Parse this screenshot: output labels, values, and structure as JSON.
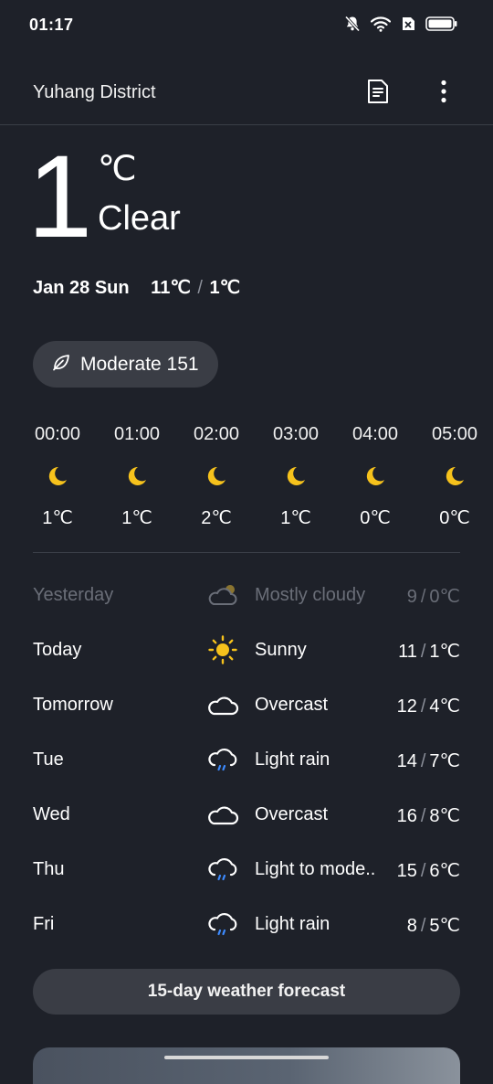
{
  "status_bar": {
    "time": "01:17",
    "icons": [
      "bell-off-icon",
      "wifi-icon",
      "sim-x-icon",
      "battery-icon"
    ]
  },
  "header": {
    "location": "Yuhang District",
    "doc_icon": "document-icon",
    "more_icon": "more-vertical-icon"
  },
  "current": {
    "temperature": "1",
    "unit": "℃",
    "condition": "Clear",
    "date": "Jan 28 Sun",
    "high": "11℃",
    "separator": "/",
    "low": "1℃"
  },
  "aqi": {
    "icon": "leaf-icon",
    "label": "Moderate 151"
  },
  "hourly": [
    {
      "time": "00:00",
      "icon": "moon-icon",
      "temp": "1℃"
    },
    {
      "time": "01:00",
      "icon": "moon-icon",
      "temp": "1℃"
    },
    {
      "time": "02:00",
      "icon": "moon-icon",
      "temp": "2℃"
    },
    {
      "time": "03:00",
      "icon": "moon-icon",
      "temp": "1℃"
    },
    {
      "time": "04:00",
      "icon": "moon-icon",
      "temp": "0℃"
    },
    {
      "time": "05:00",
      "icon": "moon-icon",
      "temp": "0℃"
    }
  ],
  "daily": [
    {
      "day": "Yesterday",
      "icon": "partly-cloudy-icon",
      "condition": "Mostly cloudy",
      "high": "9",
      "sep": "/",
      "low": "0℃"
    },
    {
      "day": "Today",
      "icon": "sun-icon",
      "condition": "Sunny",
      "high": "11",
      "sep": "/",
      "low": "1℃"
    },
    {
      "day": "Tomorrow",
      "icon": "cloud-icon",
      "condition": "Overcast",
      "high": "12",
      "sep": "/",
      "low": "4℃"
    },
    {
      "day": "Tue",
      "icon": "rain-cloud-icon",
      "condition": "Light rain",
      "high": "14",
      "sep": "/",
      "low": "7℃"
    },
    {
      "day": "Wed",
      "icon": "cloud-icon",
      "condition": "Overcast",
      "high": "16",
      "sep": "/",
      "low": "8℃"
    },
    {
      "day": "Thu",
      "icon": "rain-cloud-icon",
      "condition": "Light to mode..",
      "high": "15",
      "sep": "/",
      "low": "6℃"
    },
    {
      "day": "Fri",
      "icon": "rain-cloud-icon",
      "condition": "Light rain",
      "high": "8",
      "sep": "/",
      "low": "5℃"
    }
  ],
  "forecast_button": "15-day weather forecast",
  "colors": {
    "background": "#1e2129",
    "moon": "#f6c21c",
    "sun": "#f6c21c",
    "rain": "#3d8bff",
    "pill": "#3a3d45"
  }
}
